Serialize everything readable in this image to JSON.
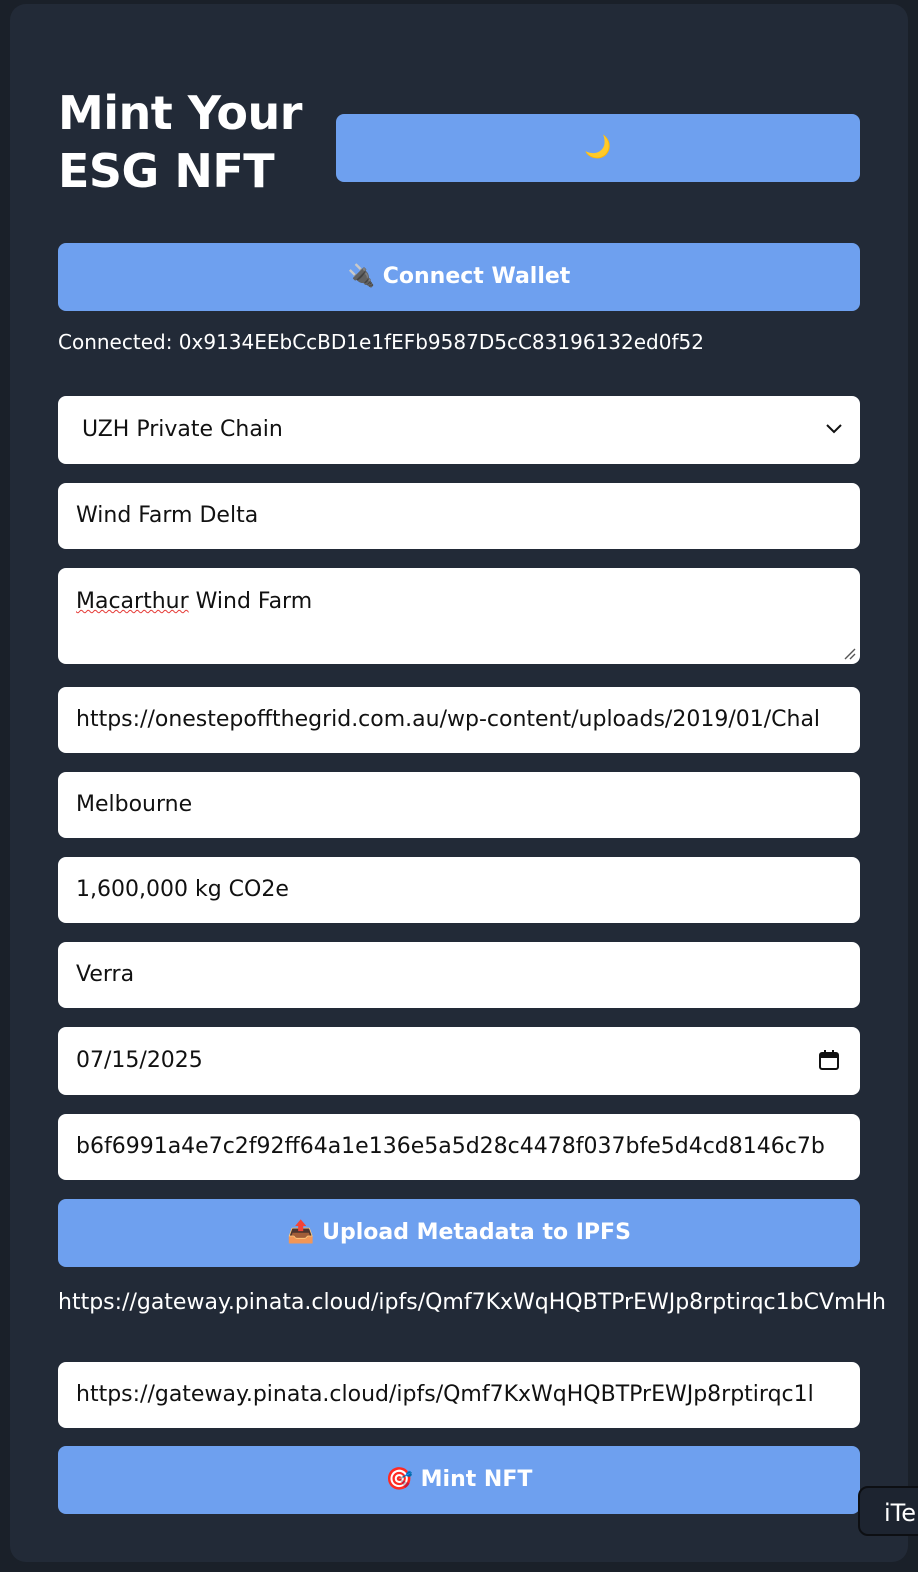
{
  "header": {
    "title": "Mint Your ESG NFT",
    "theme_toggle_icon": "🌙"
  },
  "wallet": {
    "connect_label": "🔌 Connect Wallet",
    "status": "Connected: 0x9134EEbCcBD1e1fEFb9587D5cC83196132ed0f52"
  },
  "form": {
    "network": "UZH Private Chain",
    "name": "Wind Farm Delta",
    "description_word1": "Macarthur",
    "description_rest": " Wind Farm",
    "image_url": "https://onestepoffthegrid.com.au/wp-content/uploads/2019/01/Chal",
    "location": "Melbourne",
    "co2": "1,600,000 kg CO2e",
    "certifier": "Verra",
    "date": "07/15/2025",
    "hash": "b6f6991a4e7c2f92ff64a1e136e5a5d28c4478f037bfe5d4cd8146c7b"
  },
  "ipfs": {
    "upload_label": "📤 Upload Metadata to IPFS",
    "result_link": "https://gateway.pinata.cloud/ipfs/Qmf7KxWqHQBTPrEWJp8rptirqc1bCVmHh",
    "token_uri": "https://gateway.pinata.cloud/ipfs/Qmf7KxWqHQBTPrEWJp8rptirqc1l"
  },
  "mint": {
    "label": "🎯 Mint NFT"
  },
  "tooltip": {
    "text": "iTe"
  }
}
